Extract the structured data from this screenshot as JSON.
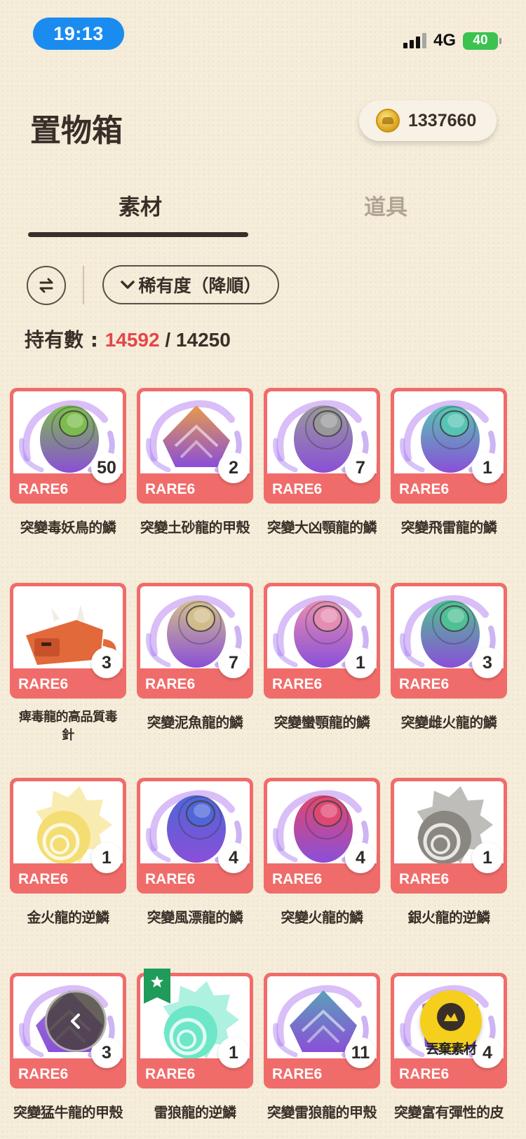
{
  "status_bar": {
    "time": "19:13",
    "network": "4G",
    "battery": "40"
  },
  "header": {
    "title": "置物箱",
    "coins": "1337660",
    "coin_icon": "gold-coin-icon"
  },
  "tabs": [
    {
      "label": "素材",
      "active": true
    },
    {
      "label": "道具",
      "active": false
    }
  ],
  "sort": {
    "toggle_icon": "swap-arrows-icon",
    "label": "稀有度（降順）"
  },
  "owned": {
    "prefix": "持有數 : ",
    "current": "14592",
    "separator": " / ",
    "max": "14250"
  },
  "items": [
    {
      "name": "突變毒妖鳥的鱗",
      "rarity": "RARE6",
      "count": "50",
      "icon": "scale-icon",
      "color": "#7cc04a"
    },
    {
      "name": "突變土砂龍的甲殼",
      "rarity": "RARE6",
      "count": "2",
      "icon": "shell-icon",
      "color": "#e89a4a"
    },
    {
      "name": "突變大凶顎龍的鱗",
      "rarity": "RARE6",
      "count": "7",
      "icon": "scale-icon",
      "color": "#9a9a9a"
    },
    {
      "name": "突變飛雷龍的鱗",
      "rarity": "RARE6",
      "count": "1",
      "icon": "scale-icon",
      "color": "#56c7b4"
    },
    {
      "name": "痺毒龍的高品質毒針",
      "rarity": "RARE6",
      "count": "3",
      "icon": "creature-icon",
      "color": "#e2693a"
    },
    {
      "name": "突變泥魚龍的鱗",
      "rarity": "RARE6",
      "count": "7",
      "icon": "scale-icon",
      "color": "#d4c08a"
    },
    {
      "name": "突變蠻顎龍的鱗",
      "rarity": "RARE6",
      "count": "1",
      "icon": "scale-icon",
      "color": "#e98fb3"
    },
    {
      "name": "突變雌火龍的鱗",
      "rarity": "RARE6",
      "count": "3",
      "icon": "scale-icon",
      "color": "#4fc493"
    },
    {
      "name": "金火龍的逆鱗",
      "rarity": "RARE6",
      "count": "1",
      "icon": "spiky-scale-icon",
      "color": "#f4dd72"
    },
    {
      "name": "突變風漂龍的鱗",
      "rarity": "RARE6",
      "count": "4",
      "icon": "scale-icon",
      "color": "#4e66d8"
    },
    {
      "name": "突變火龍的鱗",
      "rarity": "RARE6",
      "count": "4",
      "icon": "scale-icon",
      "color": "#e2476e"
    },
    {
      "name": "銀火龍的逆鱗",
      "rarity": "RARE6",
      "count": "1",
      "icon": "spiky-scale-icon",
      "color": "#8a8780"
    },
    {
      "name": "突變猛牛龍的甲殼",
      "rarity": "RARE6",
      "count": "3",
      "icon": "shell-icon",
      "color": "#9b7ad8"
    },
    {
      "name": "雷狼龍的逆鱗",
      "rarity": "RARE6",
      "count": "1",
      "icon": "spiky-scale-icon",
      "color": "#6ee6c8",
      "favorite": true
    },
    {
      "name": "突變雷狼龍的甲殼",
      "rarity": "RARE6",
      "count": "11",
      "icon": "shell-icon",
      "color": "#5aa0b8"
    },
    {
      "name": "突變富有彈性的皮",
      "rarity": "RARE6",
      "count": "4",
      "icon": "hide-icon",
      "color": "#b48ad8"
    }
  ],
  "floating": {
    "back_icon": "chevron-left-icon",
    "discard_label": "丟棄素材",
    "discard_icon": "discard-material-icon"
  }
}
